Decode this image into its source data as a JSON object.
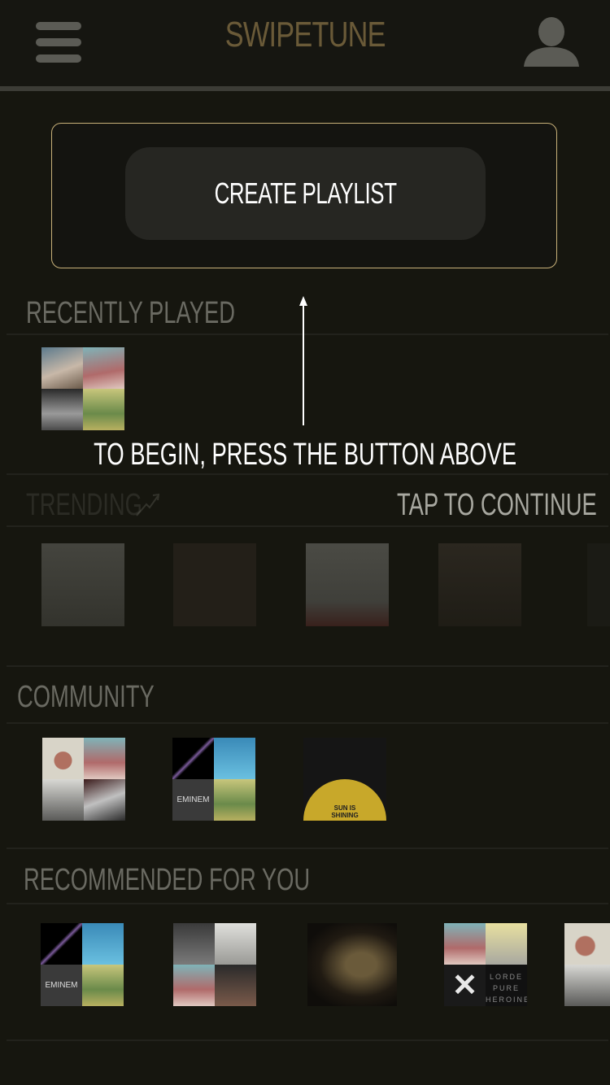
{
  "header": {
    "title": "SWIPETUNE",
    "menu_icon": "hamburger-menu-icon",
    "profile_icon": "user-profile-icon"
  },
  "create": {
    "button_label": "CREATE PLAYLIST"
  },
  "sections": {
    "recently_played": {
      "title": "RECENTLY PLAYED"
    },
    "trending": {
      "title": "TRENDING"
    },
    "community": {
      "title": "COMMUNITY",
      "sun_text_line1": "SUN IS",
      "sun_text_line2": "SHINING"
    },
    "recommended": {
      "title": "RECOMMENDED FOR YOU",
      "lorde_line1": "LORDE",
      "lorde_line2": "PURE",
      "lorde_line3": "HEROINE"
    }
  },
  "tutorial": {
    "instruction": "TO BEGIN, PRESS THE BUTTON ABOVE",
    "continue_label": "TAP TO CONTINUE"
  },
  "colors": {
    "background": "#16160f",
    "accent_border": "#c9b27a",
    "title": "#6a5a38"
  }
}
